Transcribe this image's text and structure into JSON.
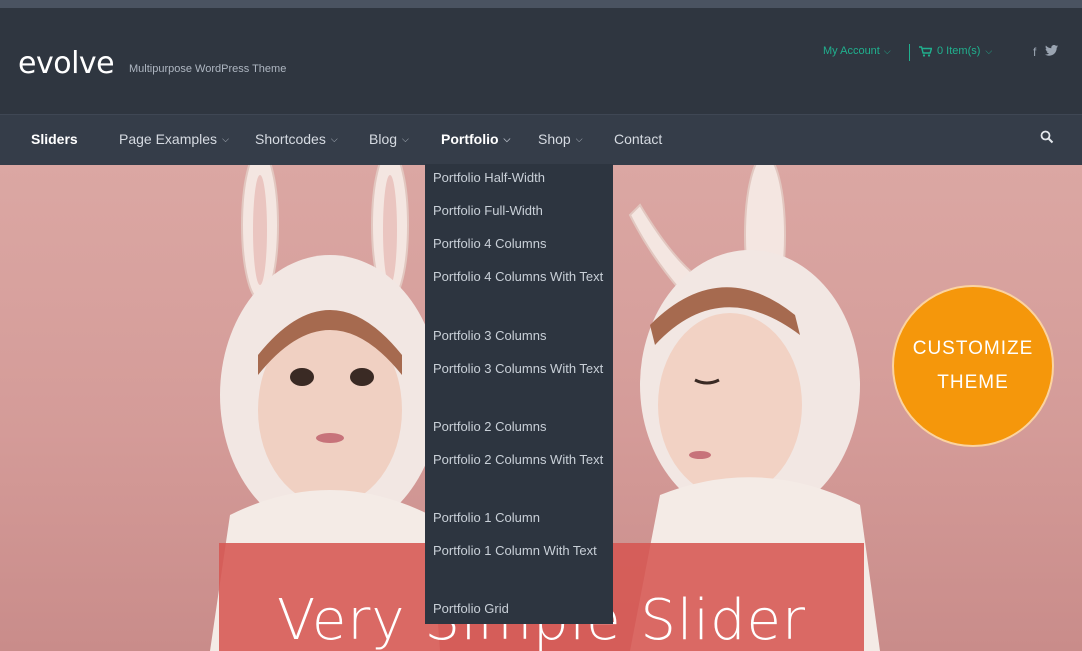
{
  "header": {
    "logo": "evolve",
    "tagline": "Multipurpose WordPress Theme",
    "account_label": "My Account",
    "cart_label": "0 Item(s)",
    "social": [
      "f",
      "t"
    ]
  },
  "nav": {
    "items": [
      {
        "label": "Sliders",
        "has_dropdown": false
      },
      {
        "label": "Page Examples",
        "has_dropdown": true
      },
      {
        "label": "Shortcodes",
        "has_dropdown": true
      },
      {
        "label": "Blog",
        "has_dropdown": true
      },
      {
        "label": "Portfolio",
        "has_dropdown": true,
        "active": true
      },
      {
        "label": "Shop",
        "has_dropdown": true
      },
      {
        "label": "Contact",
        "has_dropdown": false
      }
    ],
    "chevron": "⌵",
    "search_icon": "search-icon"
  },
  "portfolio_menu": [
    "Portfolio Half-Width",
    "Portfolio Full-Width",
    "Portfolio 4 Columns",
    "Portfolio 4 Columns With Text",
    "Portfolio 3 Columns",
    "Portfolio 3 Columns With Text",
    "Portfolio 2 Columns",
    "Portfolio 2 Columns With Text",
    "Portfolio 1 Column",
    "Portfolio 1 Column With Text",
    "Portfolio Grid"
  ],
  "hero": {
    "caption": "Very Simple Slider"
  },
  "customize": {
    "line1": "CUSTOMIZE",
    "line2": "THEME"
  },
  "colors": {
    "accent": "#20b08e",
    "header_bg": "#2f3640",
    "nav_bg": "#353d49",
    "caption_bg": "#d65752",
    "customize_bg": "#f5970b"
  }
}
